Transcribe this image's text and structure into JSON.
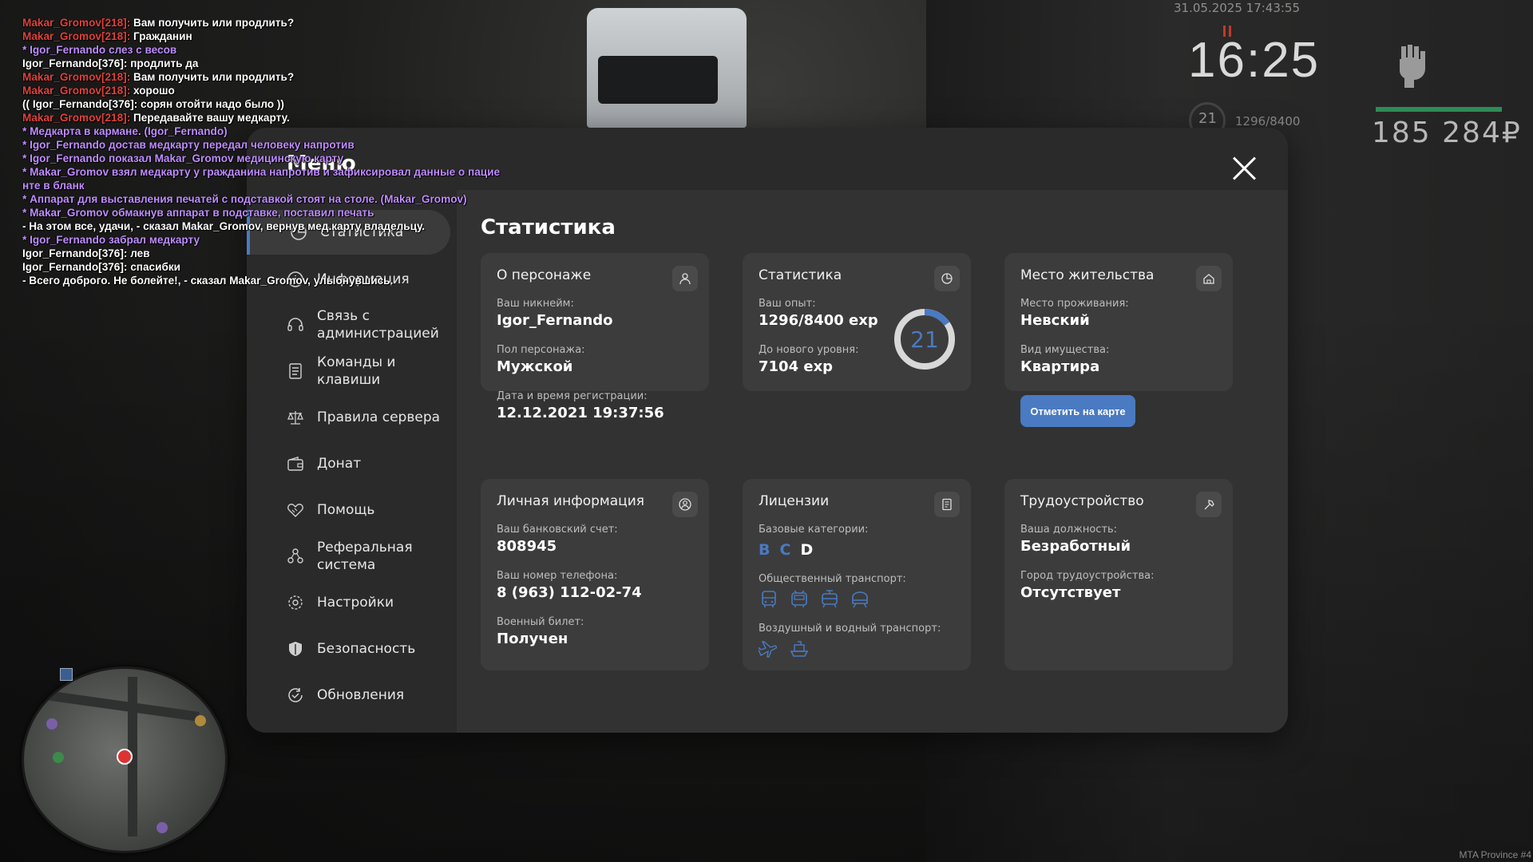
{
  "hud": {
    "datetime": "31.05.2025 17:43:55",
    "clock": "16:25",
    "level": "21",
    "exp": "1296/8400",
    "money": "185 284₽",
    "server": "MTA Province #4"
  },
  "chat": [
    {
      "parts": [
        {
          "t": "Makar_Gromov[218]:",
          "c": "red"
        },
        {
          "t": " Вам получить или продлить?",
          "c": "white"
        }
      ]
    },
    {
      "parts": [
        {
          "t": "Makar_Gromov[218]:",
          "c": "red"
        },
        {
          "t": " Гражданин",
          "c": "white"
        }
      ]
    },
    {
      "parts": [
        {
          "t": "* Igor_Fernando слез с весов",
          "c": "purple"
        }
      ]
    },
    {
      "parts": [
        {
          "t": "Igor_Fernando[376]: продлить да",
          "c": "white"
        }
      ]
    },
    {
      "parts": [
        {
          "t": "Makar_Gromov[218]:",
          "c": "red"
        },
        {
          "t": " Вам получить или продлить?",
          "c": "white"
        }
      ]
    },
    {
      "parts": [
        {
          "t": "Makar_Gromov[218]:",
          "c": "red"
        },
        {
          "t": " хорошо",
          "c": "white"
        }
      ]
    },
    {
      "parts": [
        {
          "t": "(( Igor_Fernando[376]: сорян отойти надо было ))",
          "c": "white"
        }
      ]
    },
    {
      "parts": [
        {
          "t": "Makar_Gromov[218]:",
          "c": "red"
        },
        {
          "t": " Передавайте вашу медкарту.",
          "c": "white"
        }
      ]
    },
    {
      "parts": [
        {
          "t": "* Медкарта в кармане. (Igor_Fernando)",
          "c": "purple"
        }
      ]
    },
    {
      "parts": [
        {
          "t": "* Igor_Fernando достав медкарту передал человеку напротив",
          "c": "purple"
        }
      ]
    },
    {
      "parts": [
        {
          "t": "* Igor_Fernando показал Makar_Gromov медицинскую карту",
          "c": "purple"
        }
      ]
    },
    {
      "parts": [
        {
          "t": "* Makar_Gromov взял медкарту у гражданина напротив и зафиксировал данные о пацие",
          "c": "purple"
        }
      ]
    },
    {
      "parts": [
        {
          "t": "нте в бланк",
          "c": "purple"
        }
      ]
    },
    {
      "parts": [
        {
          "t": "* Аппарат для выставления печатей с подставкой стоят на столе. (Makar_Gromov)",
          "c": "purple"
        }
      ]
    },
    {
      "parts": [
        {
          "t": "* Makar_Gromov обмакнув аппарат в подставке, поставил печать",
          "c": "purple"
        }
      ]
    },
    {
      "parts": [
        {
          "t": "- На этом все, удачи, - сказал Makar_Gromov, вернув мед.карту владельцу.",
          "c": "white"
        }
      ]
    },
    {
      "parts": [
        {
          "t": "* Igor_Fernando забрал медкарту",
          "c": "purple"
        }
      ]
    },
    {
      "parts": [
        {
          "t": "Igor_Fernando[376]: лев",
          "c": "white"
        }
      ]
    },
    {
      "parts": [
        {
          "t": "Igor_Fernando[376]: спасибки",
          "c": "white"
        }
      ]
    },
    {
      "parts": [
        {
          "t": "- Всего доброго. Не болейте!, - сказал Makar_Gromov, улыбнувшись.",
          "c": "white"
        }
      ]
    }
  ],
  "menu": {
    "title": "Меню",
    "nav": [
      {
        "label": "Статистика",
        "icon": "chart-pie-icon"
      },
      {
        "label": "Информация",
        "icon": "info-icon"
      },
      {
        "label": "Связь с администрацией",
        "icon": "headset-icon"
      },
      {
        "label": "Команды и клавиши",
        "icon": "list-icon"
      },
      {
        "label": "Правила сервера",
        "icon": "scales-icon"
      },
      {
        "label": "Донат",
        "icon": "wallet-icon"
      },
      {
        "label": "Помощь",
        "icon": "handshake-icon"
      },
      {
        "label": "Реферальная система",
        "icon": "referral-icon"
      },
      {
        "label": "Настройки",
        "icon": "gear-icon"
      },
      {
        "label": "Безопасность",
        "icon": "shield-icon"
      },
      {
        "label": "Обновления",
        "icon": "update-icon"
      }
    ],
    "content_title": "Статистика"
  },
  "cards": {
    "character": {
      "title": "О персонаже",
      "nick_label": "Ваш никнейм:",
      "nick": "Igor_Fernando",
      "sex_label": "Пол персонажа:",
      "sex": "Мужской",
      "reg_label": "Дата и время регистрации:",
      "reg": "12.12.2021 19:37:56"
    },
    "stats": {
      "title": "Статистика",
      "exp_label": "Ваш опыт:",
      "exp": "1296/8400 exp",
      "next_label": "До нового уровня:",
      "next": "7104 exp",
      "level": "21",
      "progress": 0.154
    },
    "residence": {
      "title": "Место жительства",
      "place_label": "Место проживания:",
      "place": "Невский",
      "type_label": "Вид имущества:",
      "type": "Квартира",
      "button": "Отметить на карте"
    },
    "personal": {
      "title": "Личная информация",
      "bank_label": "Ваш банковский счет:",
      "bank": "808945",
      "phone_label": "Ваш номер телефона:",
      "phone": "8 (963) 112-02-74",
      "military_label": "Военный билет:",
      "military": "Получен"
    },
    "licenses": {
      "title": "Лицензии",
      "base_label": "Базовые категории:",
      "categories": [
        {
          "l": "B",
          "on": true
        },
        {
          "l": "C",
          "on": true
        },
        {
          "l": "D",
          "on": false
        }
      ],
      "public_label": "Общественный транспорт:",
      "public_icons": [
        "bus-icon",
        "trolleybus-icon",
        "tram-icon",
        "metro-icon"
      ],
      "air_label": "Воздушный и водный транспорт:",
      "air_icons": [
        "plane-icon",
        "boat-icon"
      ]
    },
    "job": {
      "title": "Трудоустройство",
      "position_label": "Ваша должность:",
      "position": "Безработный",
      "city_label": "Город трудоустройства:",
      "city": "Отсутствует"
    }
  },
  "colors": {
    "accent": "#4a7ac2",
    "panel": "#242424",
    "card": "#3c3c3c"
  }
}
